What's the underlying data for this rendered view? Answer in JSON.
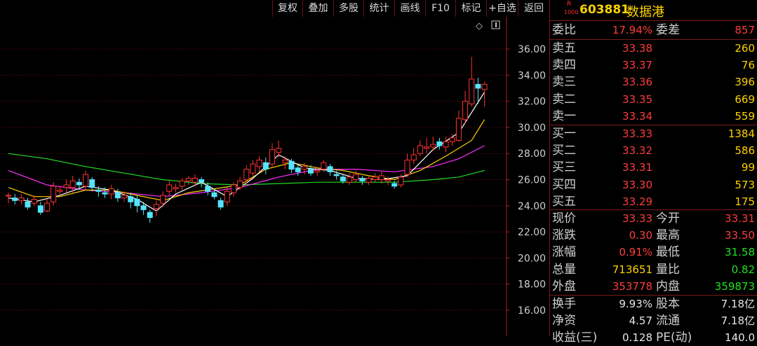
{
  "toolbar": {
    "buttons": [
      "复权",
      "叠加",
      "多股",
      "统计",
      "画线",
      "F10",
      "标记",
      "+自选",
      "返回"
    ]
  },
  "stock": {
    "market_r": "R",
    "market_code": "1000",
    "code": "603881",
    "name": "数据港"
  },
  "weibi": {
    "label": "委比",
    "value": "17.94%",
    "diff_label": "委差",
    "diff_value": "857"
  },
  "sell": [
    {
      "label": "卖五",
      "price": "33.38",
      "vol": "260"
    },
    {
      "label": "卖四",
      "price": "33.37",
      "vol": "76"
    },
    {
      "label": "卖三",
      "price": "33.36",
      "vol": "396"
    },
    {
      "label": "卖二",
      "price": "33.35",
      "vol": "669"
    },
    {
      "label": "卖一",
      "price": "33.34",
      "vol": "559"
    }
  ],
  "buy": [
    {
      "label": "买一",
      "price": "33.33",
      "vol": "1384"
    },
    {
      "label": "买二",
      "price": "33.32",
      "vol": "586"
    },
    {
      "label": "买三",
      "price": "33.31",
      "vol": "99"
    },
    {
      "label": "买四",
      "price": "33.30",
      "vol": "573"
    },
    {
      "label": "买五",
      "price": "33.29",
      "vol": "175"
    }
  ],
  "quote": [
    {
      "l1": "现价",
      "v1": "33.33",
      "c1": "red",
      "l2": "今开",
      "v2": "33.31",
      "c2": "red"
    },
    {
      "l1": "涨跌",
      "v1": "0.30",
      "c1": "red",
      "l2": "最高",
      "v2": "33.50",
      "c2": "red"
    },
    {
      "l1": "涨幅",
      "v1": "0.91%",
      "c1": "red",
      "l2": "最低",
      "v2": "31.58",
      "c2": "grn"
    },
    {
      "l1": "总量",
      "v1": "713651",
      "c1": "yel",
      "l2": "量比",
      "v2": "0.82",
      "c2": "grn"
    },
    {
      "l1": "外盘",
      "v1": "353778",
      "c1": "red",
      "l2": "内盘",
      "v2": "359873",
      "c2": "grn"
    }
  ],
  "extra": [
    {
      "l1": "换手",
      "v1": "9.93%",
      "l2": "股本",
      "v2": "7.18亿"
    },
    {
      "l1": "净资",
      "v1": "4.57",
      "l2": "流通",
      "v2": "7.18亿"
    },
    {
      "l1": "收益(三)",
      "v1": "0.128",
      "l2": "PE(动)",
      "v2": "140.0"
    }
  ],
  "chart_data": {
    "type": "candlestick",
    "y_ticks": [
      "36.00",
      "34.00",
      "32.00",
      "30.00",
      "28.00",
      "26.00",
      "24.00",
      "22.00",
      "20.00",
      "18.00",
      "16.00"
    ],
    "ylim": [
      15.0,
      38.0
    ],
    "grid": "dotted",
    "colors": {
      "up": "#ff3232",
      "down": "#54e5ff",
      "ma5": "#ffffff",
      "ma10": "#ffd200",
      "ma20": "#ff30ff",
      "ma60": "#22dd22"
    },
    "candles": [
      [
        24.8,
        24.8,
        25.0,
        24.2
      ],
      [
        24.6,
        24.4,
        24.9,
        24.1
      ],
      [
        24.4,
        24.6,
        24.9,
        24.1
      ],
      [
        24.3,
        23.9,
        24.6,
        23.7
      ],
      [
        24.2,
        24.5,
        24.8,
        24.0
      ],
      [
        24.0,
        23.5,
        24.3,
        23.3
      ],
      [
        23.6,
        24.2,
        24.5,
        23.5
      ],
      [
        24.3,
        25.5,
        25.8,
        24.0
      ],
      [
        25.1,
        25.2,
        25.5,
        24.8
      ],
      [
        25.4,
        25.6,
        26.0,
        25.0
      ],
      [
        25.4,
        25.9,
        26.3,
        25.0
      ],
      [
        25.8,
        25.6,
        26.1,
        25.2
      ],
      [
        25.5,
        26.4,
        26.7,
        25.2
      ],
      [
        26.0,
        25.4,
        26.2,
        25.1
      ],
      [
        25.2,
        25.1,
        25.5,
        24.7
      ],
      [
        25.0,
        24.9,
        25.4,
        24.6
      ],
      [
        24.9,
        25.3,
        25.6,
        24.5
      ],
      [
        25.0,
        24.6,
        25.3,
        24.3
      ],
      [
        24.6,
        24.8,
        25.1,
        24.3
      ],
      [
        24.7,
        24.3,
        25.0,
        23.8
      ],
      [
        24.5,
        24.0,
        24.8,
        23.5
      ],
      [
        24.0,
        23.7,
        24.3,
        23.3
      ],
      [
        23.5,
        23.1,
        23.7,
        22.7
      ],
      [
        23.8,
        24.1,
        24.4,
        23.2
      ],
      [
        24.2,
        24.8,
        25.1,
        23.9
      ],
      [
        25.1,
        25.6,
        25.9,
        24.8
      ],
      [
        25.3,
        25.4,
        25.7,
        25.0
      ],
      [
        25.5,
        25.9,
        26.1,
        25.2
      ],
      [
        25.9,
        26.1,
        26.3,
        25.6
      ],
      [
        25.8,
        26.1,
        26.4,
        25.5
      ],
      [
        26.0,
        25.8,
        26.2,
        25.4
      ],
      [
        25.5,
        25.1,
        25.8,
        24.8
      ],
      [
        25.0,
        24.7,
        25.3,
        24.5
      ],
      [
        24.4,
        23.9,
        24.6,
        23.7
      ],
      [
        24.3,
        25.1,
        25.4,
        24.0
      ],
      [
        25.0,
        25.6,
        25.8,
        24.7
      ],
      [
        25.4,
        25.9,
        26.2,
        25.2
      ],
      [
        26.0,
        26.8,
        27.1,
        25.7
      ],
      [
        26.5,
        27.2,
        27.5,
        26.3
      ],
      [
        27.0,
        27.5,
        27.8,
        26.6
      ],
      [
        27.3,
        26.8,
        27.7,
        26.4
      ],
      [
        27.2,
        28.3,
        28.8,
        27.0
      ],
      [
        28.1,
        28.4,
        29.0,
        27.7
      ],
      [
        27.3,
        27.5,
        27.8,
        26.8
      ],
      [
        27.4,
        26.8,
        27.6,
        26.5
      ],
      [
        26.9,
        26.6,
        27.2,
        26.3
      ],
      [
        26.8,
        27.0,
        27.3,
        26.4
      ],
      [
        26.8,
        26.5,
        27.1,
        26.3
      ],
      [
        26.6,
        26.7,
        27.0,
        26.3
      ],
      [
        26.8,
        27.3,
        27.5,
        26.6
      ],
      [
        27.0,
        26.6,
        27.2,
        26.3
      ],
      [
        26.4,
        26.3,
        26.7,
        26.0
      ],
      [
        26.2,
        25.9,
        26.4,
        25.7
      ],
      [
        25.8,
        26.2,
        26.5,
        25.6
      ],
      [
        26.0,
        26.4,
        26.7,
        25.8
      ],
      [
        26.1,
        25.9,
        26.3,
        25.6
      ],
      [
        25.8,
        26.1,
        26.3,
        25.6
      ],
      [
        26.0,
        26.2,
        26.5,
        25.8
      ],
      [
        26.0,
        26.3,
        26.6,
        25.7
      ],
      [
        25.9,
        26.0,
        26.2,
        25.6
      ],
      [
        25.7,
        25.5,
        25.9,
        25.3
      ],
      [
        25.6,
        26.2,
        26.4,
        25.4
      ],
      [
        26.4,
        27.5,
        28.0,
        26.2
      ],
      [
        27.5,
        27.9,
        28.4,
        27.2
      ],
      [
        28.0,
        28.6,
        29.0,
        27.8
      ],
      [
        28.4,
        28.5,
        29.2,
        28.0
      ],
      [
        28.5,
        28.7,
        29.3,
        28.2
      ],
      [
        28.9,
        28.6,
        29.2,
        28.3
      ],
      [
        28.5,
        28.9,
        29.3,
        28.1
      ],
      [
        28.9,
        29.2,
        29.5,
        28.6
      ],
      [
        29.0,
        30.7,
        31.3,
        28.9
      ],
      [
        30.6,
        32.0,
        32.8,
        30.3
      ],
      [
        31.8,
        33.7,
        35.4,
        31.6
      ],
      [
        33.3,
        33.0,
        33.8,
        31.8
      ],
      [
        32.9,
        33.3,
        33.5,
        31.6
      ]
    ],
    "ma5": [
      [
        0,
        24.6
      ],
      [
        4,
        24.3
      ],
      [
        8,
        24.8
      ],
      [
        12,
        25.5
      ],
      [
        16,
        25.2
      ],
      [
        20,
        24.5
      ],
      [
        23,
        23.6
      ],
      [
        26,
        24.9
      ],
      [
        30,
        25.8
      ],
      [
        34,
        24.7
      ],
      [
        38,
        26.1
      ],
      [
        42,
        27.9
      ],
      [
        46,
        26.9
      ],
      [
        50,
        26.7
      ],
      [
        54,
        26.1
      ],
      [
        58,
        26.0
      ],
      [
        62,
        26.3
      ],
      [
        66,
        28.3
      ],
      [
        70,
        29.6
      ],
      [
        74,
        32.7
      ]
    ],
    "ma10": [
      [
        0,
        25.4
      ],
      [
        4,
        24.7
      ],
      [
        8,
        24.7
      ],
      [
        12,
        25.2
      ],
      [
        16,
        25.2
      ],
      [
        20,
        24.8
      ],
      [
        24,
        24.4
      ],
      [
        28,
        25.0
      ],
      [
        32,
        25.3
      ],
      [
        36,
        25.6
      ],
      [
        40,
        26.8
      ],
      [
        44,
        27.3
      ],
      [
        48,
        26.9
      ],
      [
        52,
        26.7
      ],
      [
        56,
        26.3
      ],
      [
        60,
        26.0
      ],
      [
        64,
        26.7
      ],
      [
        68,
        27.8
      ],
      [
        72,
        29.0
      ],
      [
        74,
        30.6
      ]
    ],
    "ma20": [
      [
        0,
        26.7
      ],
      [
        6,
        25.6
      ],
      [
        12,
        25.2
      ],
      [
        18,
        25.0
      ],
      [
        24,
        24.7
      ],
      [
        30,
        25.0
      ],
      [
        36,
        25.4
      ],
      [
        42,
        26.2
      ],
      [
        48,
        26.8
      ],
      [
        54,
        26.8
      ],
      [
        60,
        26.6
      ],
      [
        66,
        27.0
      ],
      [
        70,
        27.6
      ],
      [
        74,
        28.6
      ]
    ],
    "ma60": [
      [
        0,
        28.0
      ],
      [
        6,
        27.6
      ],
      [
        12,
        27.0
      ],
      [
        18,
        26.5
      ],
      [
        24,
        26.0
      ],
      [
        30,
        25.7
      ],
      [
        36,
        25.6
      ],
      [
        42,
        25.7
      ],
      [
        48,
        25.8
      ],
      [
        54,
        25.8
      ],
      [
        60,
        25.8
      ],
      [
        66,
        26.0
      ],
      [
        70,
        26.2
      ],
      [
        74,
        26.7
      ]
    ]
  }
}
